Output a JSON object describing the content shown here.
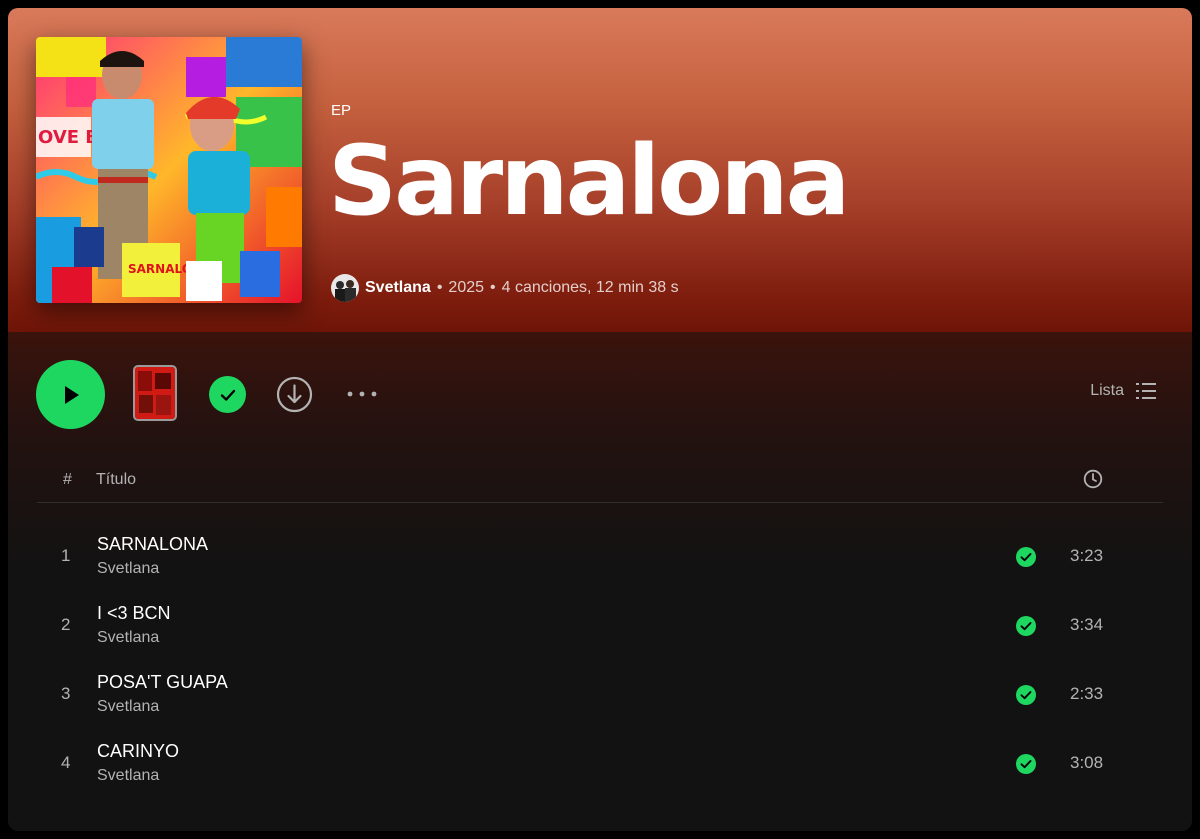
{
  "album": {
    "type": "EP",
    "title": "Sarnalona",
    "artist": "Svetlana",
    "year": "2025",
    "summary": "4 canciones, 12 min 38 s"
  },
  "controls": {
    "view_label": "Lista"
  },
  "table": {
    "col_number": "#",
    "col_title": "Título"
  },
  "tracks": [
    {
      "number": "1",
      "title": "SARNALONA",
      "artist": "Svetlana",
      "duration": "3:23",
      "saved": true
    },
    {
      "number": "2",
      "title": "I <3 BCN",
      "artist": "Svetlana",
      "duration": "3:34",
      "saved": true
    },
    {
      "number": "3",
      "title": "POSA'T GUAPA",
      "artist": "Svetlana",
      "duration": "2:33",
      "saved": true
    },
    {
      "number": "4",
      "title": "CARINYO",
      "artist": "Svetlana",
      "duration": "3:08",
      "saved": true
    }
  ],
  "colors": {
    "accent": "#1ed760",
    "hero_top": "#d97a5a",
    "hero_bottom": "#6e1508",
    "background": "#121212"
  }
}
